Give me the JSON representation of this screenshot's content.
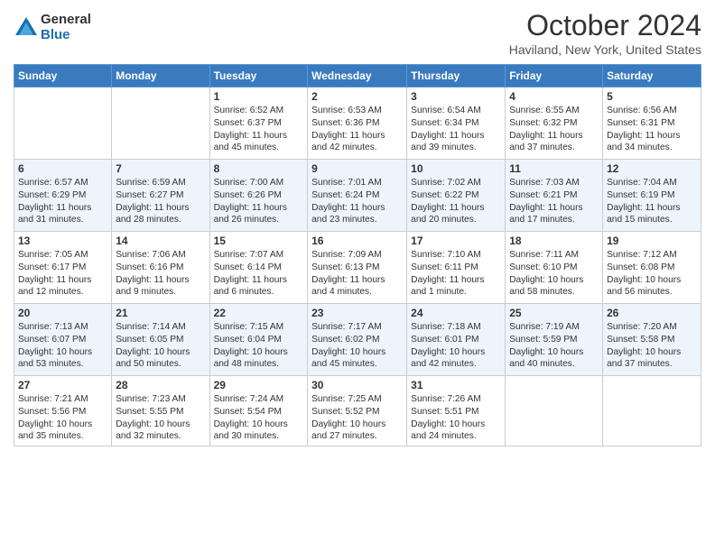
{
  "logo": {
    "general": "General",
    "blue": "Blue"
  },
  "header": {
    "month": "October 2024",
    "location": "Haviland, New York, United States"
  },
  "days_of_week": [
    "Sunday",
    "Monday",
    "Tuesday",
    "Wednesday",
    "Thursday",
    "Friday",
    "Saturday"
  ],
  "weeks": [
    [
      {
        "day": "",
        "info": ""
      },
      {
        "day": "",
        "info": ""
      },
      {
        "day": "1",
        "info": "Sunrise: 6:52 AM\nSunset: 6:37 PM\nDaylight: 11 hours and 45 minutes."
      },
      {
        "day": "2",
        "info": "Sunrise: 6:53 AM\nSunset: 6:36 PM\nDaylight: 11 hours and 42 minutes."
      },
      {
        "day": "3",
        "info": "Sunrise: 6:54 AM\nSunset: 6:34 PM\nDaylight: 11 hours and 39 minutes."
      },
      {
        "day": "4",
        "info": "Sunrise: 6:55 AM\nSunset: 6:32 PM\nDaylight: 11 hours and 37 minutes."
      },
      {
        "day": "5",
        "info": "Sunrise: 6:56 AM\nSunset: 6:31 PM\nDaylight: 11 hours and 34 minutes."
      }
    ],
    [
      {
        "day": "6",
        "info": "Sunrise: 6:57 AM\nSunset: 6:29 PM\nDaylight: 11 hours and 31 minutes."
      },
      {
        "day": "7",
        "info": "Sunrise: 6:59 AM\nSunset: 6:27 PM\nDaylight: 11 hours and 28 minutes."
      },
      {
        "day": "8",
        "info": "Sunrise: 7:00 AM\nSunset: 6:26 PM\nDaylight: 11 hours and 26 minutes."
      },
      {
        "day": "9",
        "info": "Sunrise: 7:01 AM\nSunset: 6:24 PM\nDaylight: 11 hours and 23 minutes."
      },
      {
        "day": "10",
        "info": "Sunrise: 7:02 AM\nSunset: 6:22 PM\nDaylight: 11 hours and 20 minutes."
      },
      {
        "day": "11",
        "info": "Sunrise: 7:03 AM\nSunset: 6:21 PM\nDaylight: 11 hours and 17 minutes."
      },
      {
        "day": "12",
        "info": "Sunrise: 7:04 AM\nSunset: 6:19 PM\nDaylight: 11 hours and 15 minutes."
      }
    ],
    [
      {
        "day": "13",
        "info": "Sunrise: 7:05 AM\nSunset: 6:17 PM\nDaylight: 11 hours and 12 minutes."
      },
      {
        "day": "14",
        "info": "Sunrise: 7:06 AM\nSunset: 6:16 PM\nDaylight: 11 hours and 9 minutes."
      },
      {
        "day": "15",
        "info": "Sunrise: 7:07 AM\nSunset: 6:14 PM\nDaylight: 11 hours and 6 minutes."
      },
      {
        "day": "16",
        "info": "Sunrise: 7:09 AM\nSunset: 6:13 PM\nDaylight: 11 hours and 4 minutes."
      },
      {
        "day": "17",
        "info": "Sunrise: 7:10 AM\nSunset: 6:11 PM\nDaylight: 11 hours and 1 minute."
      },
      {
        "day": "18",
        "info": "Sunrise: 7:11 AM\nSunset: 6:10 PM\nDaylight: 10 hours and 58 minutes."
      },
      {
        "day": "19",
        "info": "Sunrise: 7:12 AM\nSunset: 6:08 PM\nDaylight: 10 hours and 56 minutes."
      }
    ],
    [
      {
        "day": "20",
        "info": "Sunrise: 7:13 AM\nSunset: 6:07 PM\nDaylight: 10 hours and 53 minutes."
      },
      {
        "day": "21",
        "info": "Sunrise: 7:14 AM\nSunset: 6:05 PM\nDaylight: 10 hours and 50 minutes."
      },
      {
        "day": "22",
        "info": "Sunrise: 7:15 AM\nSunset: 6:04 PM\nDaylight: 10 hours and 48 minutes."
      },
      {
        "day": "23",
        "info": "Sunrise: 7:17 AM\nSunset: 6:02 PM\nDaylight: 10 hours and 45 minutes."
      },
      {
        "day": "24",
        "info": "Sunrise: 7:18 AM\nSunset: 6:01 PM\nDaylight: 10 hours and 42 minutes."
      },
      {
        "day": "25",
        "info": "Sunrise: 7:19 AM\nSunset: 5:59 PM\nDaylight: 10 hours and 40 minutes."
      },
      {
        "day": "26",
        "info": "Sunrise: 7:20 AM\nSunset: 5:58 PM\nDaylight: 10 hours and 37 minutes."
      }
    ],
    [
      {
        "day": "27",
        "info": "Sunrise: 7:21 AM\nSunset: 5:56 PM\nDaylight: 10 hours and 35 minutes."
      },
      {
        "day": "28",
        "info": "Sunrise: 7:23 AM\nSunset: 5:55 PM\nDaylight: 10 hours and 32 minutes."
      },
      {
        "day": "29",
        "info": "Sunrise: 7:24 AM\nSunset: 5:54 PM\nDaylight: 10 hours and 30 minutes."
      },
      {
        "day": "30",
        "info": "Sunrise: 7:25 AM\nSunset: 5:52 PM\nDaylight: 10 hours and 27 minutes."
      },
      {
        "day": "31",
        "info": "Sunrise: 7:26 AM\nSunset: 5:51 PM\nDaylight: 10 hours and 24 minutes."
      },
      {
        "day": "",
        "info": ""
      },
      {
        "day": "",
        "info": ""
      }
    ]
  ]
}
